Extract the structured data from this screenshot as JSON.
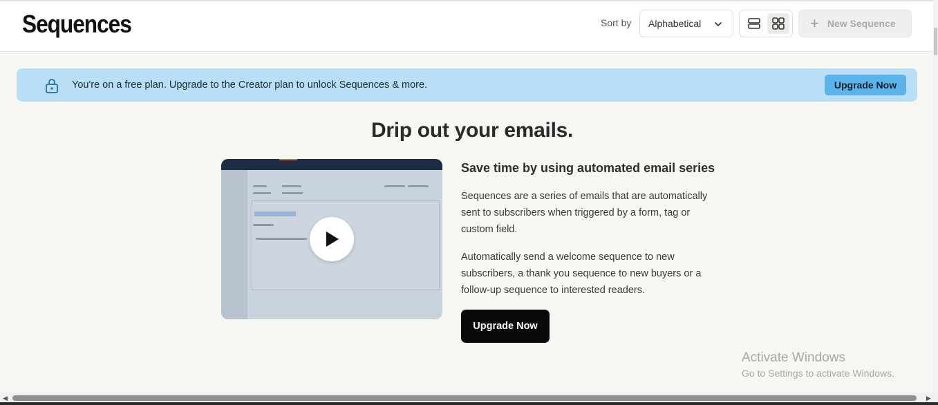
{
  "header": {
    "title": "Sequences",
    "sort_label": "Sort by",
    "sort_value": "Alphabetical",
    "new_button_label": "New Sequence"
  },
  "banner": {
    "text": "You're on a free plan. Upgrade to the Creator plan to unlock Sequences & more.",
    "button_label": "Upgrade Now",
    "color": "#b9dff6",
    "button_color": "#5cb3ea"
  },
  "hero": {
    "title": "Drip out your emails.",
    "heading": "Save time by using automated email series",
    "paragraph_1": "Sequences are a series of emails that are automatically sent to subscribers when triggered by a form, tag or custom field.",
    "paragraph_2": "Automatically send a welcome sequence to new subscribers, a thank you sequence to new buyers or a follow-up sequence to interested readers.",
    "cta_label": "Upgrade Now"
  },
  "watermark": {
    "line1": "Activate Windows",
    "line2": "Go to Settings to activate Windows."
  }
}
